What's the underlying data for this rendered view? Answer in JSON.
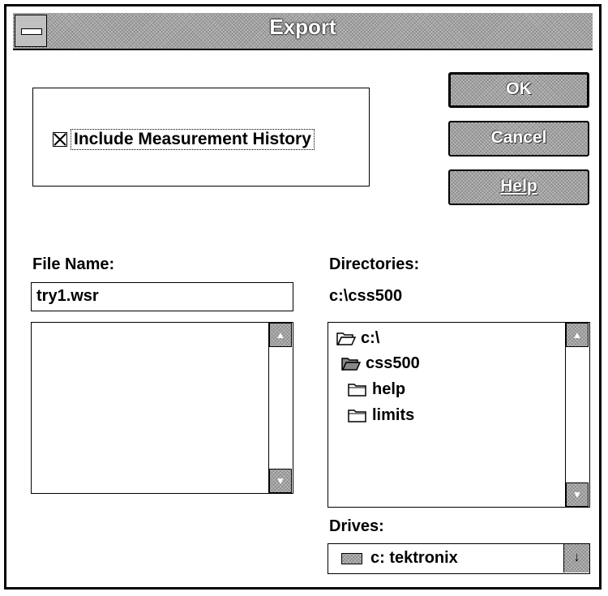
{
  "window": {
    "title": "Export"
  },
  "options": {
    "include_history_label": "Include Measurement History",
    "include_history_checked": true
  },
  "buttons": {
    "ok": "OK",
    "cancel": "Cancel",
    "help": "Help"
  },
  "file_name": {
    "label": "File Name:",
    "value": "try1.wsr",
    "files": []
  },
  "directories": {
    "label": "Directories:",
    "current": "c:\\css500",
    "items": [
      {
        "name": "c:\\",
        "icon": "open-folder-icon"
      },
      {
        "name": "css500",
        "icon": "open-folder-icon"
      },
      {
        "name": "help",
        "icon": "folder-icon"
      },
      {
        "name": "limits",
        "icon": "folder-icon"
      }
    ]
  },
  "drives": {
    "label": "Drives:",
    "selected": "c: tektronix",
    "icon": "drive-icon"
  },
  "icons": {
    "scroll_up": "▲",
    "scroll_down": "▼",
    "dropdown": "↓"
  }
}
